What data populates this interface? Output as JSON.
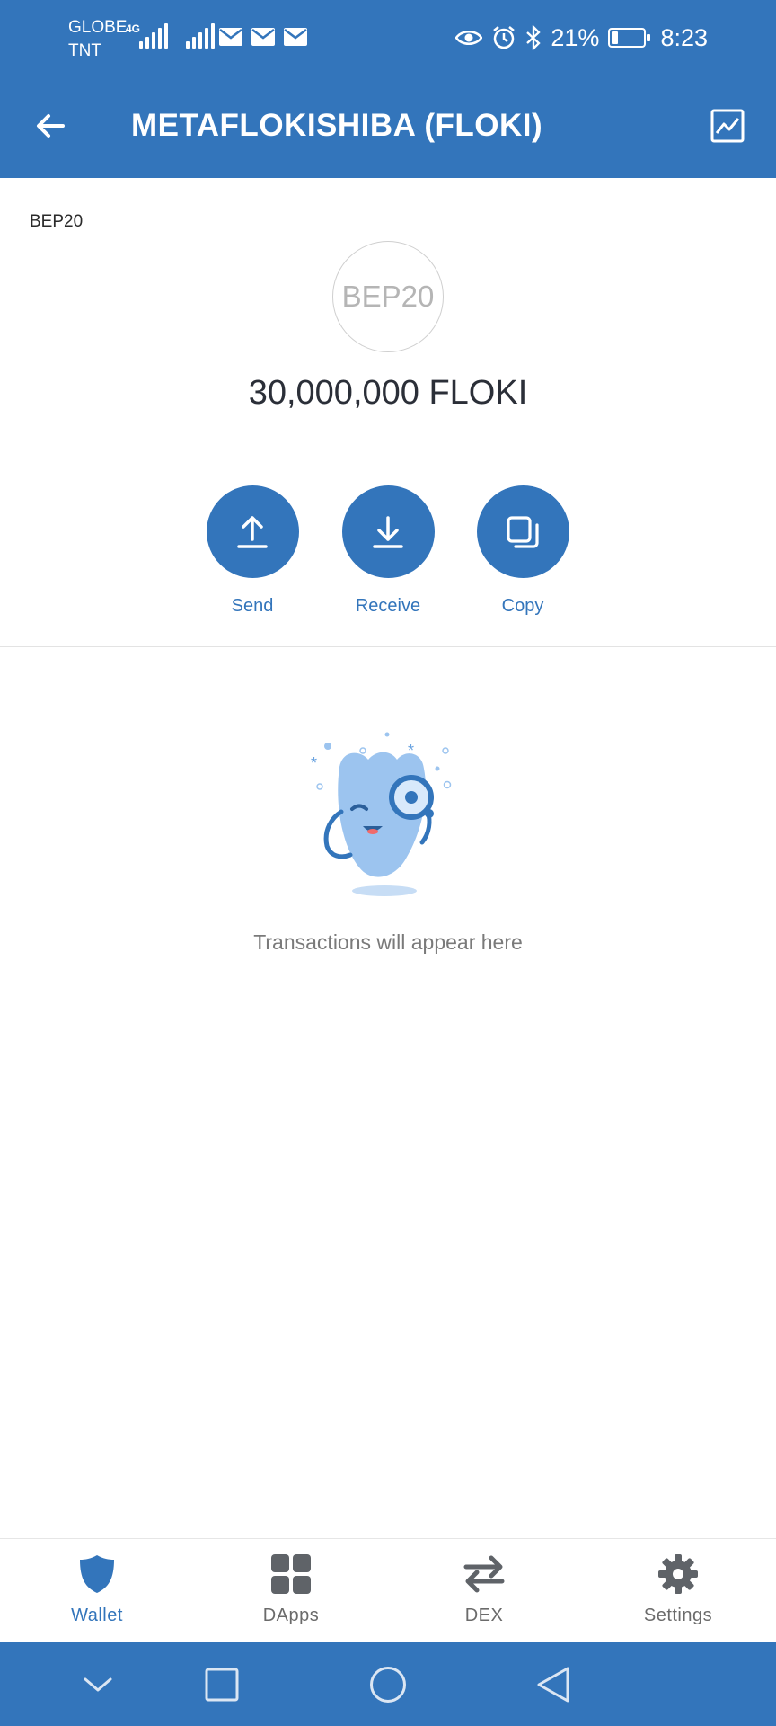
{
  "status_bar": {
    "carrier_line1": "GLOBE",
    "carrier_line2": "TNT",
    "network_type": "4G",
    "battery_percent": "21%",
    "battery_level": 0.21,
    "time": "8:23",
    "icons": [
      "signal-icon",
      "mail-icon",
      "eye-icon",
      "alarm-icon",
      "bluetooth-icon",
      "battery-icon"
    ]
  },
  "header": {
    "title": "METAFLOKISHIBA (FLOKI)",
    "back_icon": "arrow-left-icon",
    "chart_icon": "chart-icon"
  },
  "token": {
    "network": "BEP20",
    "logo_text": "BEP20",
    "balance": "30,000,000 FLOKI"
  },
  "actions": [
    {
      "label": "Send",
      "icon": "upload-arrow-icon"
    },
    {
      "label": "Receive",
      "icon": "download-arrow-icon"
    },
    {
      "label": "Copy",
      "icon": "copy-icon"
    }
  ],
  "empty_state": {
    "text": "Transactions will appear here",
    "illustration": "monocle-mascot-illustration"
  },
  "bottom_nav": {
    "items": [
      {
        "label": "Wallet",
        "icon": "shield-icon",
        "active": true
      },
      {
        "label": "DApps",
        "icon": "grid-icon",
        "active": false
      },
      {
        "label": "DEX",
        "icon": "swap-arrows-icon",
        "active": false
      },
      {
        "label": "Settings",
        "icon": "gear-icon",
        "active": false
      }
    ]
  },
  "system_nav": [
    "chevron-down-icon",
    "square-icon",
    "circle-icon",
    "triangle-back-icon"
  ],
  "colors": {
    "primary": "#3375bb",
    "text_dark": "#2b2f38",
    "text_muted": "#7a7a7a",
    "nav_inactive": "#6b6b6b"
  }
}
